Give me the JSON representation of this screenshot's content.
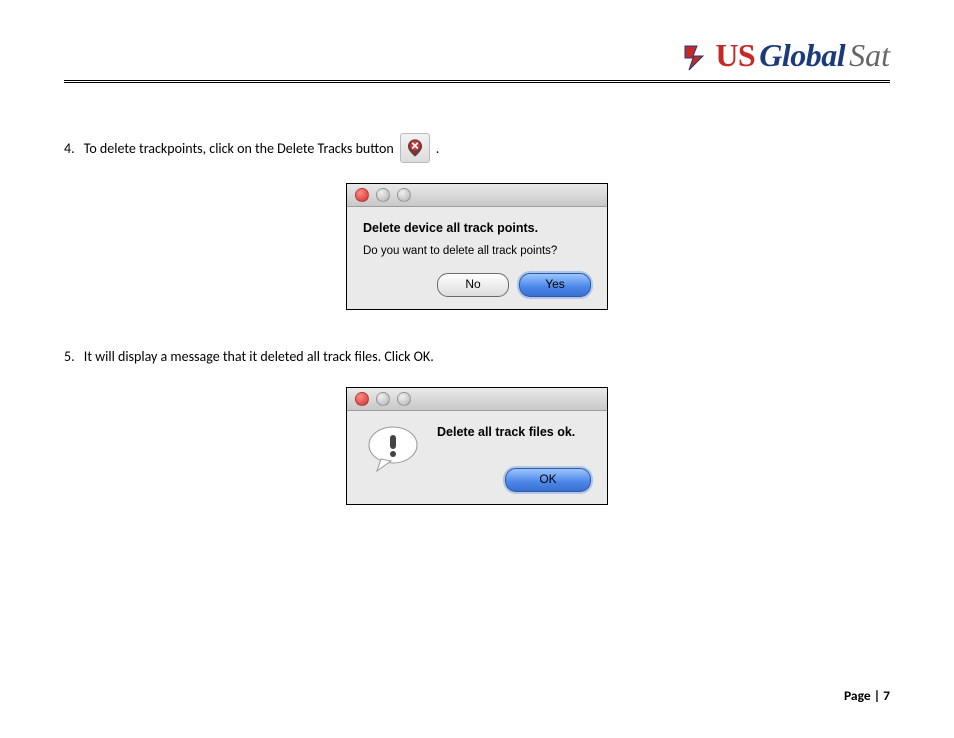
{
  "branding": {
    "us": "US",
    "global": "Global",
    "sat": "Sat"
  },
  "steps": {
    "s4_num": "4. ",
    "s4_text": "To delete trackpoints, click on the Delete Tracks button",
    "s4_trailing": ".",
    "s5_num": "5. ",
    "s5_text": "It will display a message that it deleted all track files. Click OK."
  },
  "dialog1": {
    "title": "Delete device all track points.",
    "message": "Do you want to delete all track points?",
    "no_label": "No",
    "yes_label": "Yes"
  },
  "dialog2": {
    "title": "Delete all track files ok.",
    "ok_label": "OK"
  },
  "footer": {
    "page_label": "Page | 7"
  }
}
